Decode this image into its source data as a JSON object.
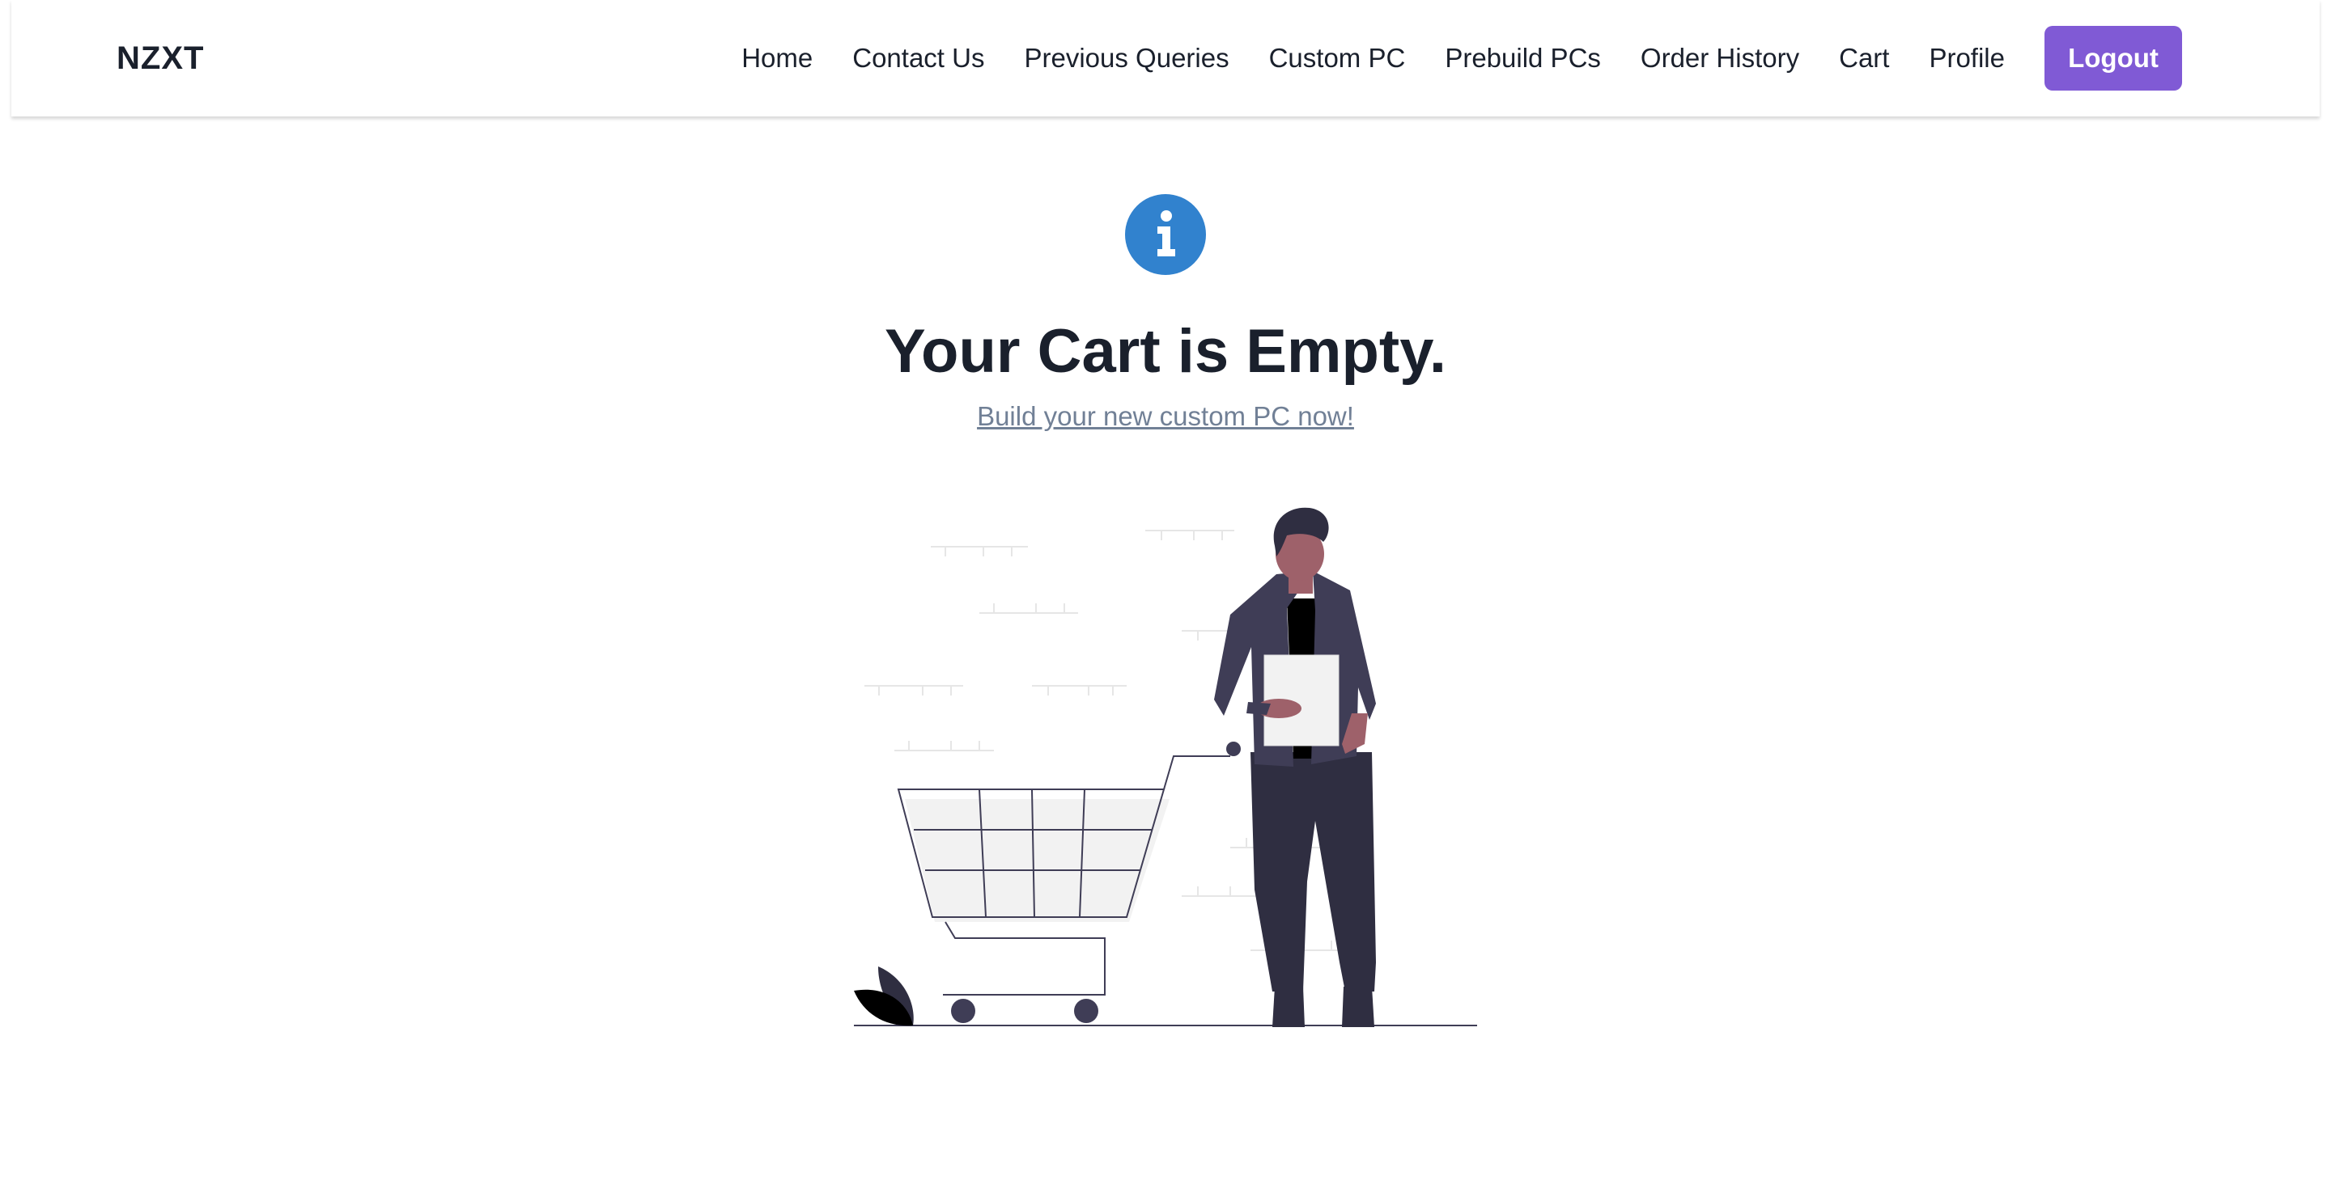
{
  "brand": "NZXT",
  "nav": {
    "links": [
      "Home",
      "Contact Us",
      "Previous Queries",
      "Custom PC",
      "Prebuild PCs",
      "Order History",
      "Cart",
      "Profile"
    ],
    "logout_label": "Logout"
  },
  "main": {
    "title": "Your Cart is Empty.",
    "cta_link": "Build your new custom PC now!",
    "info_icon": "info-icon",
    "illustration": "empty-cart-illustration"
  },
  "colors": {
    "accent": "#805ad5",
    "info": "#3182ce",
    "text": "#1a202c",
    "muted_link": "#718096"
  }
}
